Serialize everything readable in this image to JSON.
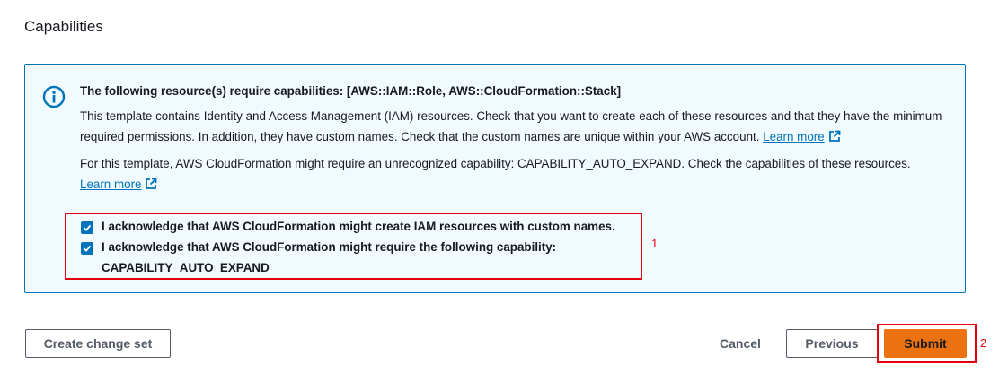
{
  "section": {
    "title": "Capabilities"
  },
  "alert": {
    "icon": "info-icon",
    "title": "The following resource(s) require capabilities: [AWS::IAM::Role, AWS::CloudFormation::Stack]",
    "para1_text": "This template contains Identity and Access Management (IAM) resources. Check that you want to create each of these resources and that they have the minimum required permissions. In addition, they have custom names. Check that the custom names are unique within your AWS account.",
    "para1_link": "Learn more",
    "para2_text": "For this template, AWS CloudFormation might require an unrecognized capability: CAPABILITY_AUTO_EXPAND. Check the capabilities of these resources.",
    "para2_link": "Learn more",
    "link_icon": "external-link-icon"
  },
  "acknowledgements": [
    {
      "label": "I acknowledge that AWS CloudFormation might create IAM resources with custom names.",
      "checked": true
    },
    {
      "label_line1": "I acknowledge that AWS CloudFormation might require the following capability:",
      "label_line2": "CAPABILITY_AUTO_EXPAND",
      "checked": true
    }
  ],
  "callouts": {
    "first": "1",
    "second": "2"
  },
  "buttons": {
    "create_change_set": "Create change set",
    "cancel": "Cancel",
    "previous": "Previous",
    "submit": "Submit"
  },
  "colors": {
    "accent": "#0073bb",
    "alert_bg": "#f1faff",
    "primary_button": "#ec7211",
    "callout_red": "#e4000f"
  }
}
